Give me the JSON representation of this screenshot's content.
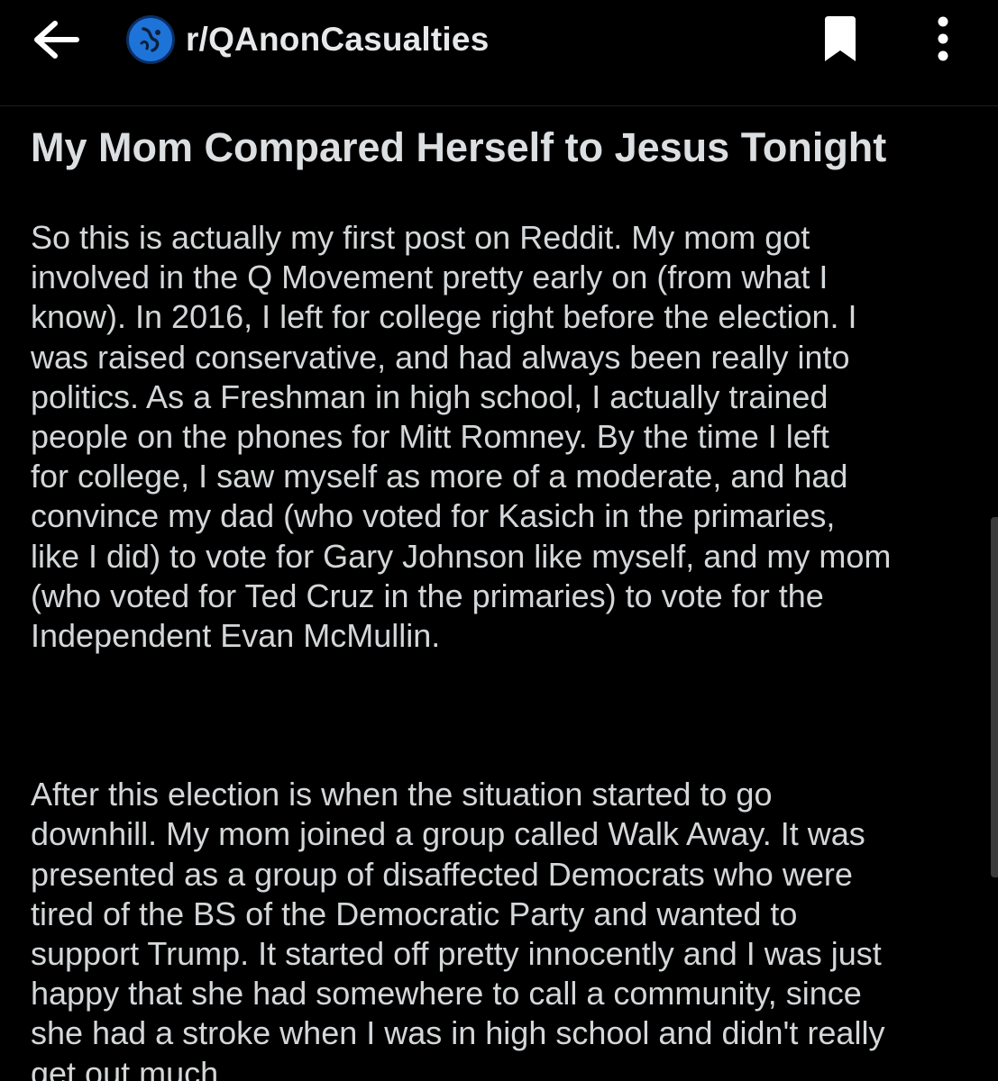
{
  "topbar": {
    "back_icon": "arrow-left-icon",
    "subreddit": "r/QAnonCasualties",
    "bookmark_icon": "bookmark-icon",
    "more_icon": "more-vertical-icon",
    "avatar_color": "#1e73d8"
  },
  "post": {
    "title": "My Mom Compared Herself to Jesus Tonight",
    "paragraphs": [
      {
        "lines": [
          "So this is actually my first post on Reddit. My mom got",
          "involved in the Q Movement pretty early on (from what I",
          "know). In 2016, I left for college right before the election. I",
          "was raised conservative, and had always been really into",
          "politics. As a Freshman in high school, I actually trained",
          "people on the phones for Mitt Romney. By the time I left",
          "for college, I saw myself as more of a moderate, and had",
          "convince my dad (who voted for Kasich in the primaries,",
          "like I did) to vote for Gary Johnson like myself, and my mom",
          "(who voted for Ted Cruz in the primaries) to vote for the",
          "Independent Evan McMullin."
        ]
      },
      {
        "lines": [
          "After this election is when the situation started to go",
          "downhill. My mom joined a group called Walk Away. It was",
          "presented as a group of disaffected Democrats who were",
          "tired of the BS of the Democratic Party and wanted to",
          "support Trump. It started off pretty innocently and I was just",
          "happy that she had somewhere to call a community, since",
          "she had a stroke when I was in high school and didn't really",
          "get out much."
        ]
      }
    ]
  },
  "colors": {
    "background": "#000000",
    "text": "#d4d7d9",
    "title": "#dcdfe1"
  }
}
